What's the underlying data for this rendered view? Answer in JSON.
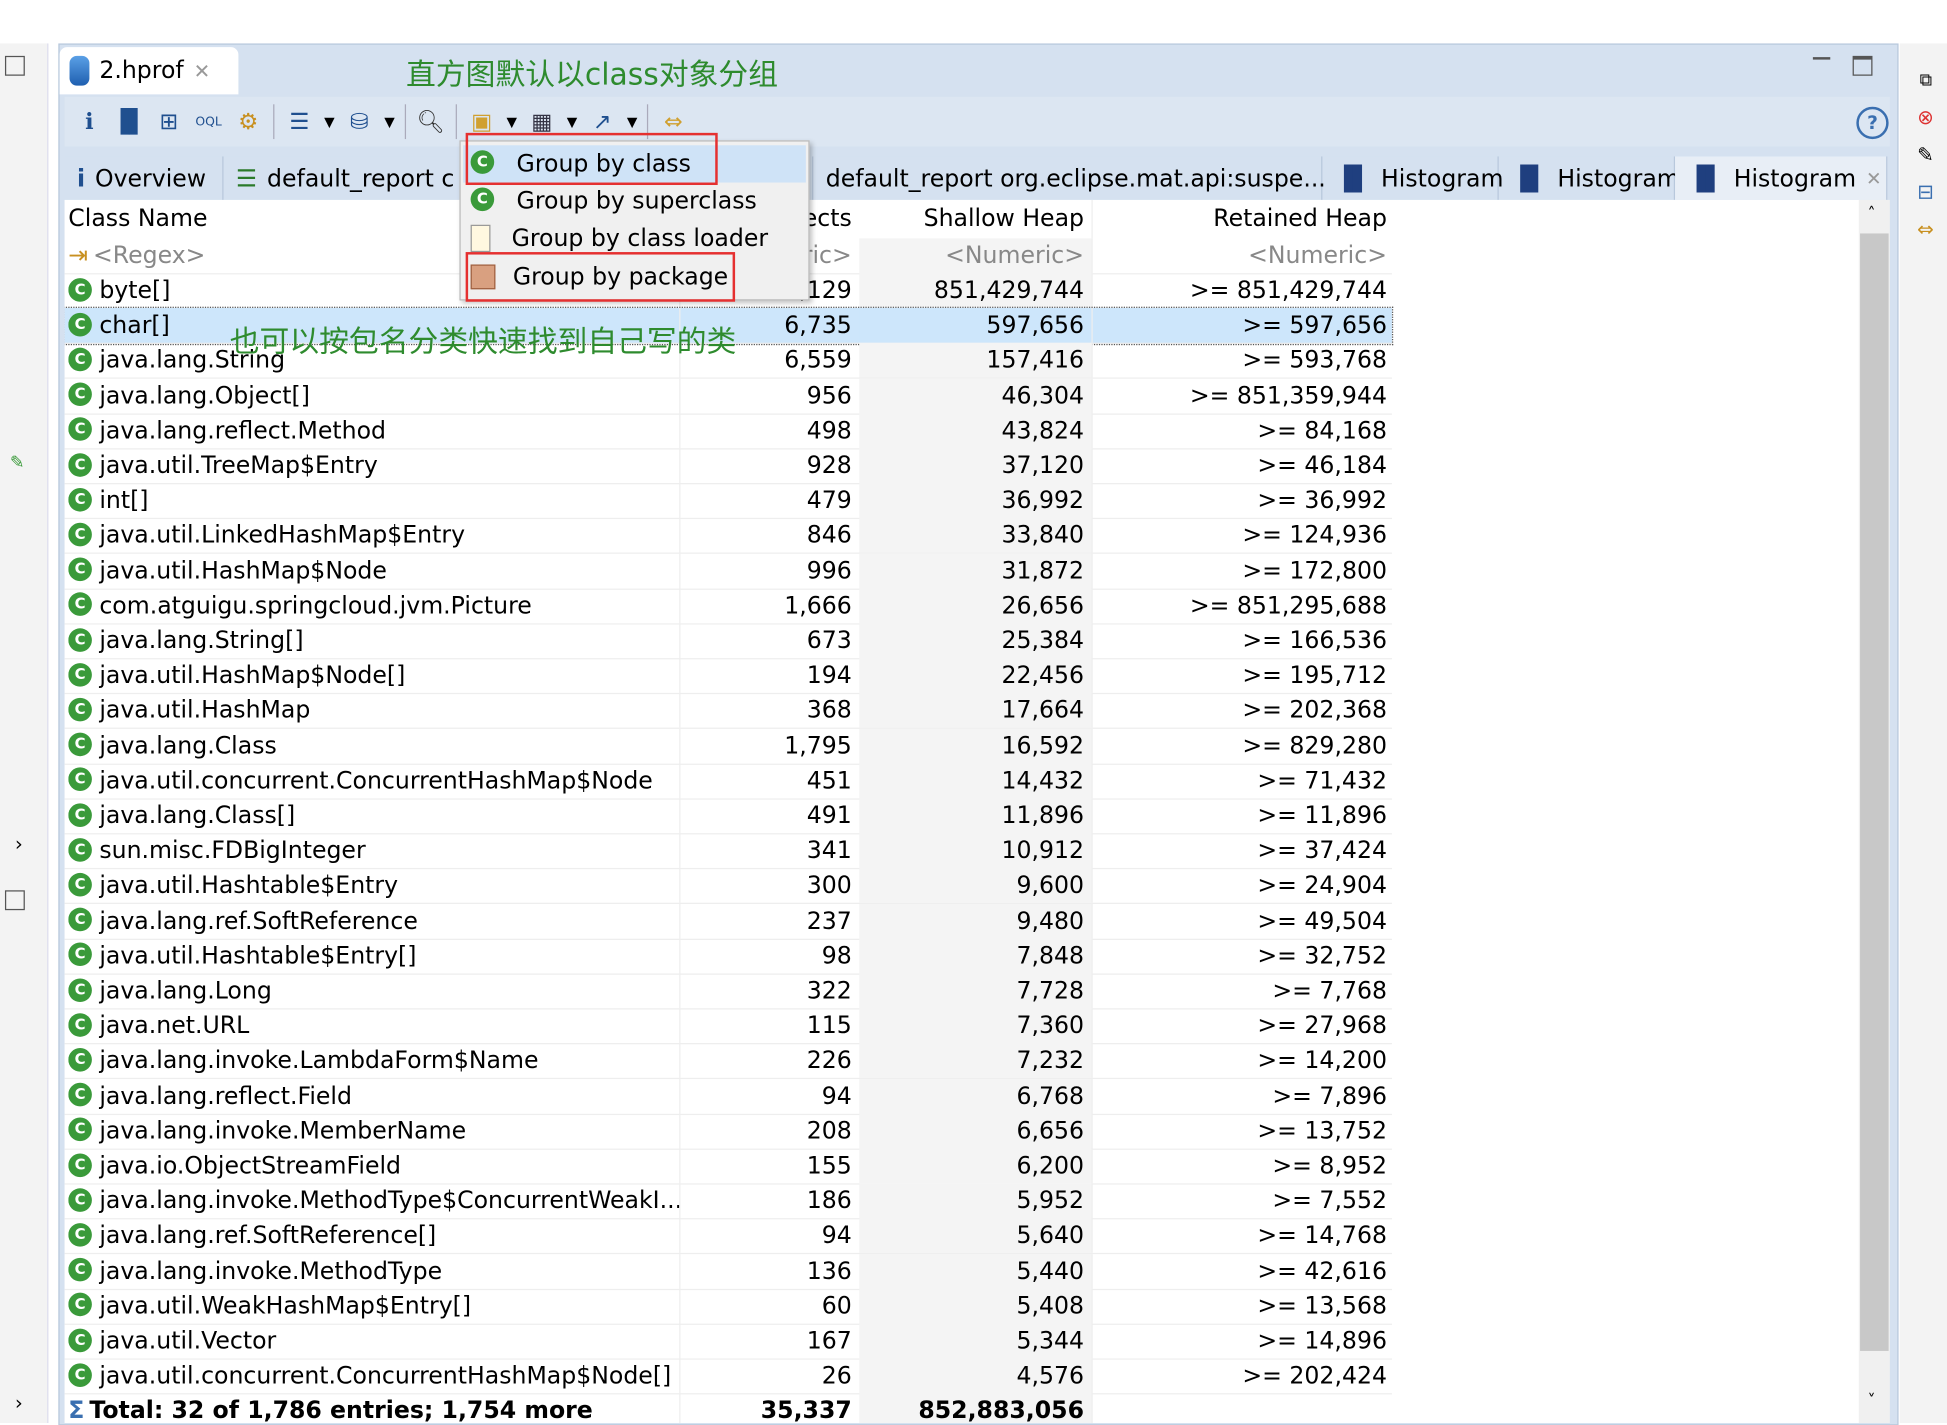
{
  "editor_tab": {
    "title": "2.hprof",
    "icon": "heap-dump-icon"
  },
  "annotations": {
    "top": "直方图默认以class对象分组",
    "middle": "也可以按包名分类快速找到自己写的类"
  },
  "toolbar": {
    "icons": [
      "info-icon",
      "histogram-icon",
      "dominator-tree-icon",
      "oql-icon",
      "gear-icon",
      "report-icon",
      "query-icon",
      "search-icon",
      "group-by-icon",
      "calculator-icon",
      "export-icon",
      "columns-icon"
    ],
    "help_icon": "help-icon"
  },
  "inner_tabs": [
    {
      "label": "Overview"
    },
    {
      "label": "default_report  c"
    },
    {
      "label": "default_report  org.eclipse.mat.api:suspe..."
    },
    {
      "label": "Histogram"
    },
    {
      "label": "Histogram"
    },
    {
      "label": "Histogram",
      "active": true
    }
  ],
  "group_menu": {
    "items": [
      {
        "label": "Group by class",
        "highlighted": true
      },
      {
        "label": "Group by superclass"
      },
      {
        "label": "Group by class loader"
      },
      {
        "label": "Group by package",
        "highlighted": true
      }
    ]
  },
  "table": {
    "headers": [
      "Class Name",
      "Objects",
      "Shallow Heap",
      "Retained Heap"
    ],
    "filters": [
      "<Regex>",
      "<Numeric>",
      "<Numeric>",
      "<Numeric>"
    ],
    "rows": [
      [
        "byte[]",
        "2,129",
        "851,429,744",
        ">= 851,429,744"
      ],
      [
        "char[]",
        "6,735",
        "597,656",
        ">= 597,656"
      ],
      [
        "java.lang.String",
        "6,559",
        "157,416",
        ">= 593,768"
      ],
      [
        "java.lang.Object[]",
        "956",
        "46,304",
        ">= 851,359,944"
      ],
      [
        "java.lang.reflect.Method",
        "498",
        "43,824",
        ">= 84,168"
      ],
      [
        "java.util.TreeMap$Entry",
        "928",
        "37,120",
        ">= 46,184"
      ],
      [
        "int[]",
        "479",
        "36,992",
        ">= 36,992"
      ],
      [
        "java.util.LinkedHashMap$Entry",
        "846",
        "33,840",
        ">= 124,936"
      ],
      [
        "java.util.HashMap$Node",
        "996",
        "31,872",
        ">= 172,800"
      ],
      [
        "com.atguigu.springcloud.jvm.Picture",
        "1,666",
        "26,656",
        ">= 851,295,688"
      ],
      [
        "java.lang.String[]",
        "673",
        "25,384",
        ">= 166,536"
      ],
      [
        "java.util.HashMap$Node[]",
        "194",
        "22,456",
        ">= 195,712"
      ],
      [
        "java.util.HashMap",
        "368",
        "17,664",
        ">= 202,368"
      ],
      [
        "java.lang.Class",
        "1,795",
        "16,592",
        ">= 829,280"
      ],
      [
        "java.util.concurrent.ConcurrentHashMap$Node",
        "451",
        "14,432",
        ">= 71,432"
      ],
      [
        "java.lang.Class[]",
        "491",
        "11,896",
        ">= 11,896"
      ],
      [
        "sun.misc.FDBigInteger",
        "341",
        "10,912",
        ">= 37,424"
      ],
      [
        "java.util.Hashtable$Entry",
        "300",
        "9,600",
        ">= 24,904"
      ],
      [
        "java.lang.ref.SoftReference",
        "237",
        "9,480",
        ">= 49,504"
      ],
      [
        "java.util.Hashtable$Entry[]",
        "98",
        "7,848",
        ">= 32,752"
      ],
      [
        "java.lang.Long",
        "322",
        "7,728",
        ">= 7,768"
      ],
      [
        "java.net.URL",
        "115",
        "7,360",
        ">= 27,968"
      ],
      [
        "java.lang.invoke.LambdaForm$Name",
        "226",
        "7,232",
        ">= 14,200"
      ],
      [
        "java.lang.reflect.Field",
        "94",
        "6,768",
        ">= 7,896"
      ],
      [
        "java.lang.invoke.MemberName",
        "208",
        "6,656",
        ">= 13,752"
      ],
      [
        "java.io.ObjectStreamField",
        "155",
        "6,200",
        ">= 8,952"
      ],
      [
        "java.lang.invoke.MethodType$ConcurrentWeakI...",
        "186",
        "5,952",
        ">= 7,552"
      ],
      [
        "java.lang.ref.SoftReference[]",
        "94",
        "5,640",
        ">= 14,768"
      ],
      [
        "java.lang.invoke.MethodType",
        "136",
        "5,440",
        ">= 42,616"
      ],
      [
        "java.util.WeakHashMap$Entry[]",
        "60",
        "5,408",
        ">= 13,568"
      ],
      [
        "java.util.Vector",
        "167",
        "5,344",
        ">= 14,896"
      ],
      [
        "java.util.concurrent.ConcurrentHashMap$Node[]",
        "26",
        "4,576",
        ">= 202,424"
      ]
    ],
    "selected_row": 1,
    "total": [
      "Total: 32 of 1,786 entries; 1,754 more",
      "35,337",
      "852,883,056",
      ""
    ]
  },
  "colors": {
    "annotation": "#2e8b2e",
    "highlight_box": "#e53030",
    "selection": "#cde6fb",
    "class_icon": "#3a9a3a"
  }
}
